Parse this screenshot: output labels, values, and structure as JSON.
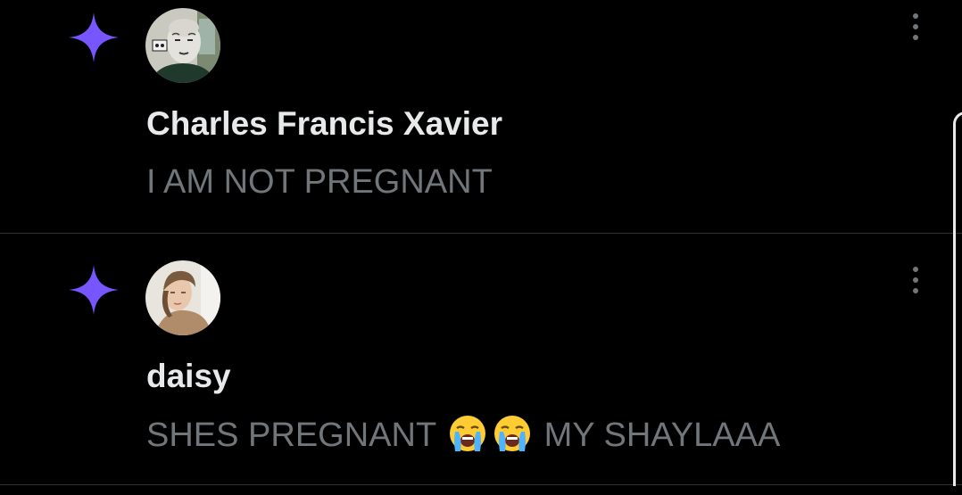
{
  "notifications": [
    {
      "type_icon": "sparkle-icon",
      "avatar": "avatar-charles",
      "name": "Charles Francis Xavier",
      "text": "I AM NOT PREGNANT",
      "menu_icon": "more-vertical-icon"
    },
    {
      "type_icon": "sparkle-icon",
      "avatar": "avatar-daisy",
      "name": "daisy",
      "text_before": "SHES PREGNANT",
      "emojis": [
        "loudly-crying-face-emoji",
        "loudly-crying-face-emoji"
      ],
      "text_after": "MY SHAYLAAA",
      "menu_icon": "more-vertical-icon"
    }
  ],
  "colors": {
    "background": "#000000",
    "sparkle": "#7856ff",
    "name": "#e7e9ea",
    "secondary_text": "#71767b",
    "divider": "#2f3336"
  }
}
